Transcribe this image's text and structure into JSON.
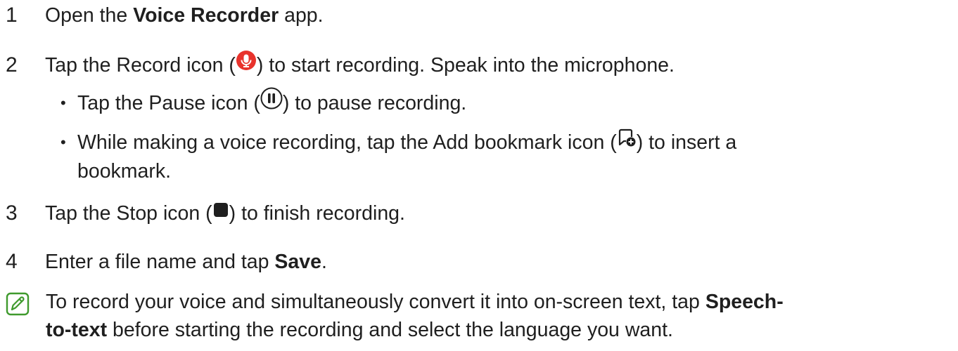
{
  "steps": [
    {
      "num": "1",
      "pre": "Open the ",
      "bold": "Voice Recorder",
      "post": " app."
    },
    {
      "num": "2",
      "pre": "Tap the Record icon (",
      "post": ") to start recording. Speak into the microphone."
    },
    {
      "num": "3",
      "pre": "Tap the Stop icon (",
      "post": ") to finish recording."
    },
    {
      "num": "4",
      "pre": "Enter a file name and tap ",
      "bold": "Save",
      "post": "."
    }
  ],
  "bullets": [
    {
      "pre": "Tap the Pause icon (",
      "post": ") to pause recording."
    },
    {
      "pre": "While making a voice recording, tap the Add bookmark icon (",
      "post": ") to insert a",
      "line2": "bookmark."
    }
  ],
  "bullet_char": "•",
  "note": {
    "pre": "To record your voice and simultaneously convert it into on-screen text, tap ",
    "bold1": "Speech-",
    "bold2": "to-text",
    "post": " before starting the recording and select the language you want."
  },
  "icons": {
    "record": "microphone-record-icon",
    "pause": "pause-icon",
    "bookmark": "add-bookmark-icon",
    "stop": "stop-icon",
    "note": "note-pencil-icon"
  },
  "colors": {
    "record_red": "#e8332c",
    "text": "#1f1f1f",
    "note_green": "#3f9a2d"
  }
}
